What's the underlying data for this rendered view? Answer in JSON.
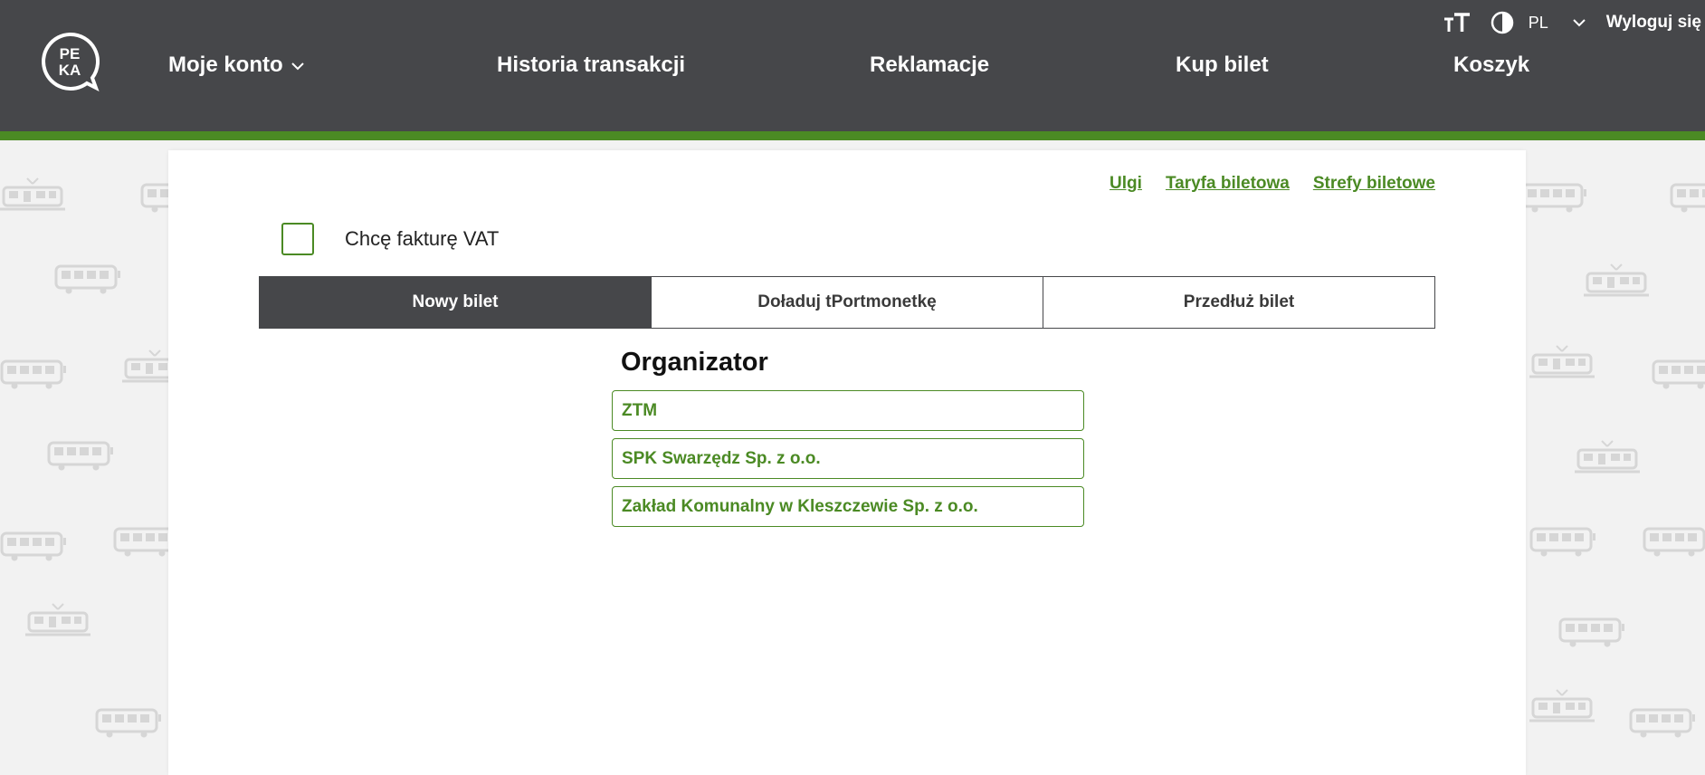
{
  "brand": {
    "logo_text_top": "PE",
    "logo_text_bottom": "KA",
    "accent_color": "#4b8a24",
    "header_color": "#46474a"
  },
  "nav": {
    "items": [
      {
        "label": "Moje konto",
        "has_dropdown": true
      },
      {
        "label": "Historia transakcji"
      },
      {
        "label": "Reklamacje"
      },
      {
        "label": "Kup bilet"
      },
      {
        "label": "Koszyk"
      }
    ]
  },
  "utility": {
    "font_size_icon": "text-size-icon",
    "contrast_icon": "contrast-icon",
    "language": "PL",
    "logout": "Wyloguj się"
  },
  "links": {
    "ulgi": "Ulgi",
    "taryfa": "Taryfa biletowa",
    "strefy": "Strefy biletowe"
  },
  "vat": {
    "label": "Chcę fakturę VAT",
    "checked": false
  },
  "tabs": [
    {
      "label": "Nowy bilet",
      "active": true
    },
    {
      "label": "Doładuj tPortmonetkę",
      "active": false
    },
    {
      "label": "Przedłuż bilet",
      "active": false
    }
  ],
  "organizer": {
    "title": "Organizator",
    "items": [
      "ZTM",
      "SPK Swarzędz Sp. z o.o.",
      "Zakład Komunalny w Kleszczewie Sp. z o.o."
    ]
  }
}
